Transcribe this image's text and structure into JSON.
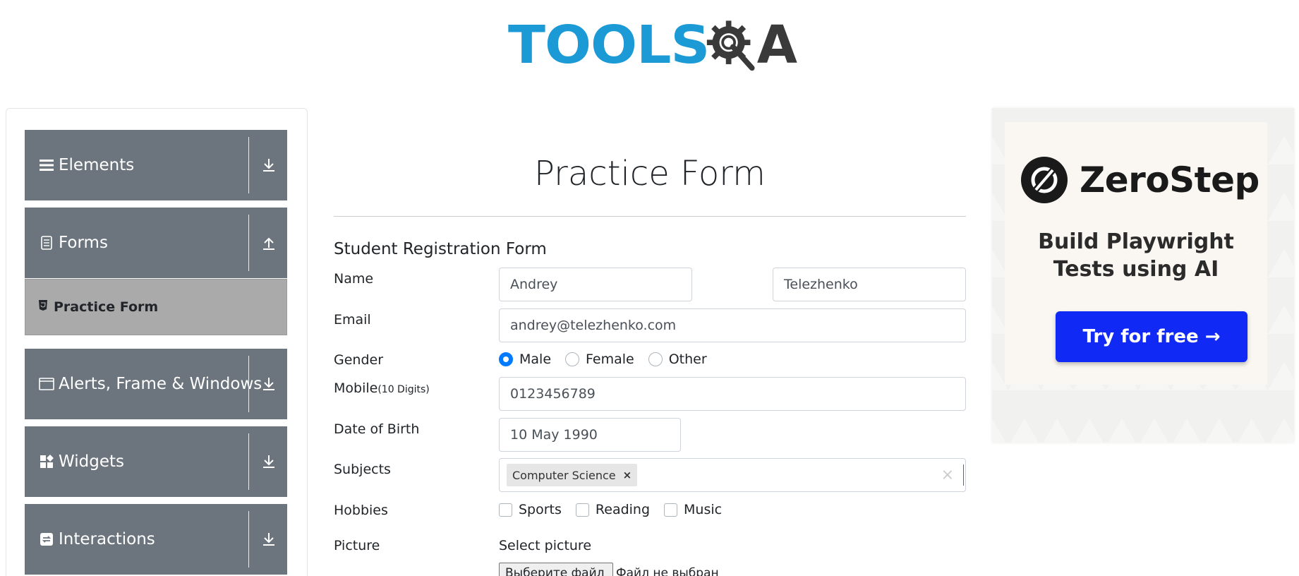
{
  "header": {
    "logo": {
      "text_left": "TOOLS",
      "text_right": "A",
      "icon": "gear-magnifier-icon",
      "color_left": "#1b9ad6",
      "color_right": "#3a3a3a"
    }
  },
  "sidebar": {
    "groups": [
      {
        "label": "Elements",
        "icon": "menu-bars-icon",
        "state": "collapsed"
      },
      {
        "label": "Forms",
        "icon": "document-icon",
        "state": "expanded"
      },
      {
        "label": "Alerts, Frame & Windows",
        "icon": "window-icon",
        "state": "collapsed"
      },
      {
        "label": "Widgets",
        "icon": "widgets-icon",
        "state": "collapsed"
      },
      {
        "label": "Interactions",
        "icon": "interactions-icon",
        "state": "collapsed"
      }
    ],
    "active_item": {
      "label": "Practice Form",
      "icon": "html5-icon"
    },
    "colors": {
      "group_bg": "#6c757d",
      "active_bg": "#aaaaaa"
    }
  },
  "main": {
    "title": "Practice Form",
    "form_heading": "Student Registration Form",
    "name": {
      "label": "Name",
      "first": "Andrey",
      "last": "Telezhenko"
    },
    "email": {
      "label": "Email",
      "value": "andrey@telezhenko.com"
    },
    "gender": {
      "label": "Gender",
      "options": [
        "Male",
        "Female",
        "Other"
      ],
      "selected": "Male"
    },
    "mobile": {
      "label": "Mobile",
      "hint": "(10 Digits)",
      "value": "0123456789"
    },
    "dob": {
      "label": "Date of Birth",
      "value": "10 May 1990"
    },
    "subjects": {
      "label": "Subjects",
      "chips": [
        "Computer Science"
      ],
      "remove_glyph": "×",
      "clear_glyph": "×"
    },
    "hobbies": {
      "label": "Hobbies",
      "options": [
        "Sports",
        "Reading",
        "Music"
      ]
    },
    "picture": {
      "label": "Picture",
      "select_text": "Select picture",
      "button": "Выберите файл",
      "status": "Файл не выбран"
    },
    "accent": "#007bff"
  },
  "ad": {
    "brand": "ZeroStep",
    "tagline_1": "Build Playwright",
    "tagline_2": "Tests using AI",
    "cta": "Try for free →",
    "cta_color": "#1029f5"
  }
}
